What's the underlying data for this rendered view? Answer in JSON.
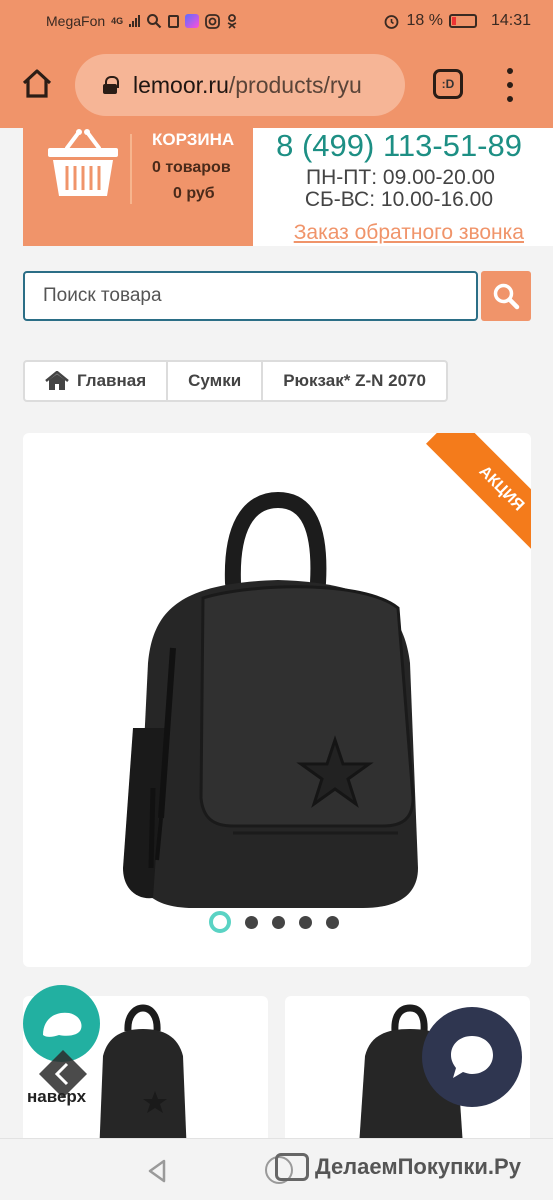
{
  "status_bar": {
    "carrier": "MegaFon",
    "network": "4G",
    "battery": "18 %",
    "time": "14:31",
    "battery_level": 0.18
  },
  "browser": {
    "url_domain": "lemoor.ru",
    "url_path": "/products/ryu",
    "tab_label": ":D"
  },
  "header": {
    "cart_title": "КОРЗИНА",
    "cart_items": "0 товаров",
    "cart_sum": "0 руб",
    "phone": "8 (499) 113-51-89",
    "hours_weekday": "ПН-ПТ: 09.00-20.00",
    "hours_weekend": "СБ-ВС: 10.00-16.00",
    "callback": "Заказ обратного звонка"
  },
  "search": {
    "placeholder": "Поиск товара"
  },
  "breadcrumb": {
    "items": [
      "Главная",
      "Сумки",
      "Рюкзак* Z-N 2070"
    ]
  },
  "product": {
    "badge": "АКЦИЯ",
    "slide_count": 5,
    "active_slide": 1
  },
  "widgets": {
    "up_label": "наверх"
  },
  "navbar": {
    "watermark": "ДелаемПокупки.Ру"
  },
  "colors": {
    "accent": "#f0946a",
    "teal": "#1d8f84",
    "badge": "#f47b1b",
    "chat_left": "#22b0a1",
    "chat_right": "#2f3650"
  }
}
